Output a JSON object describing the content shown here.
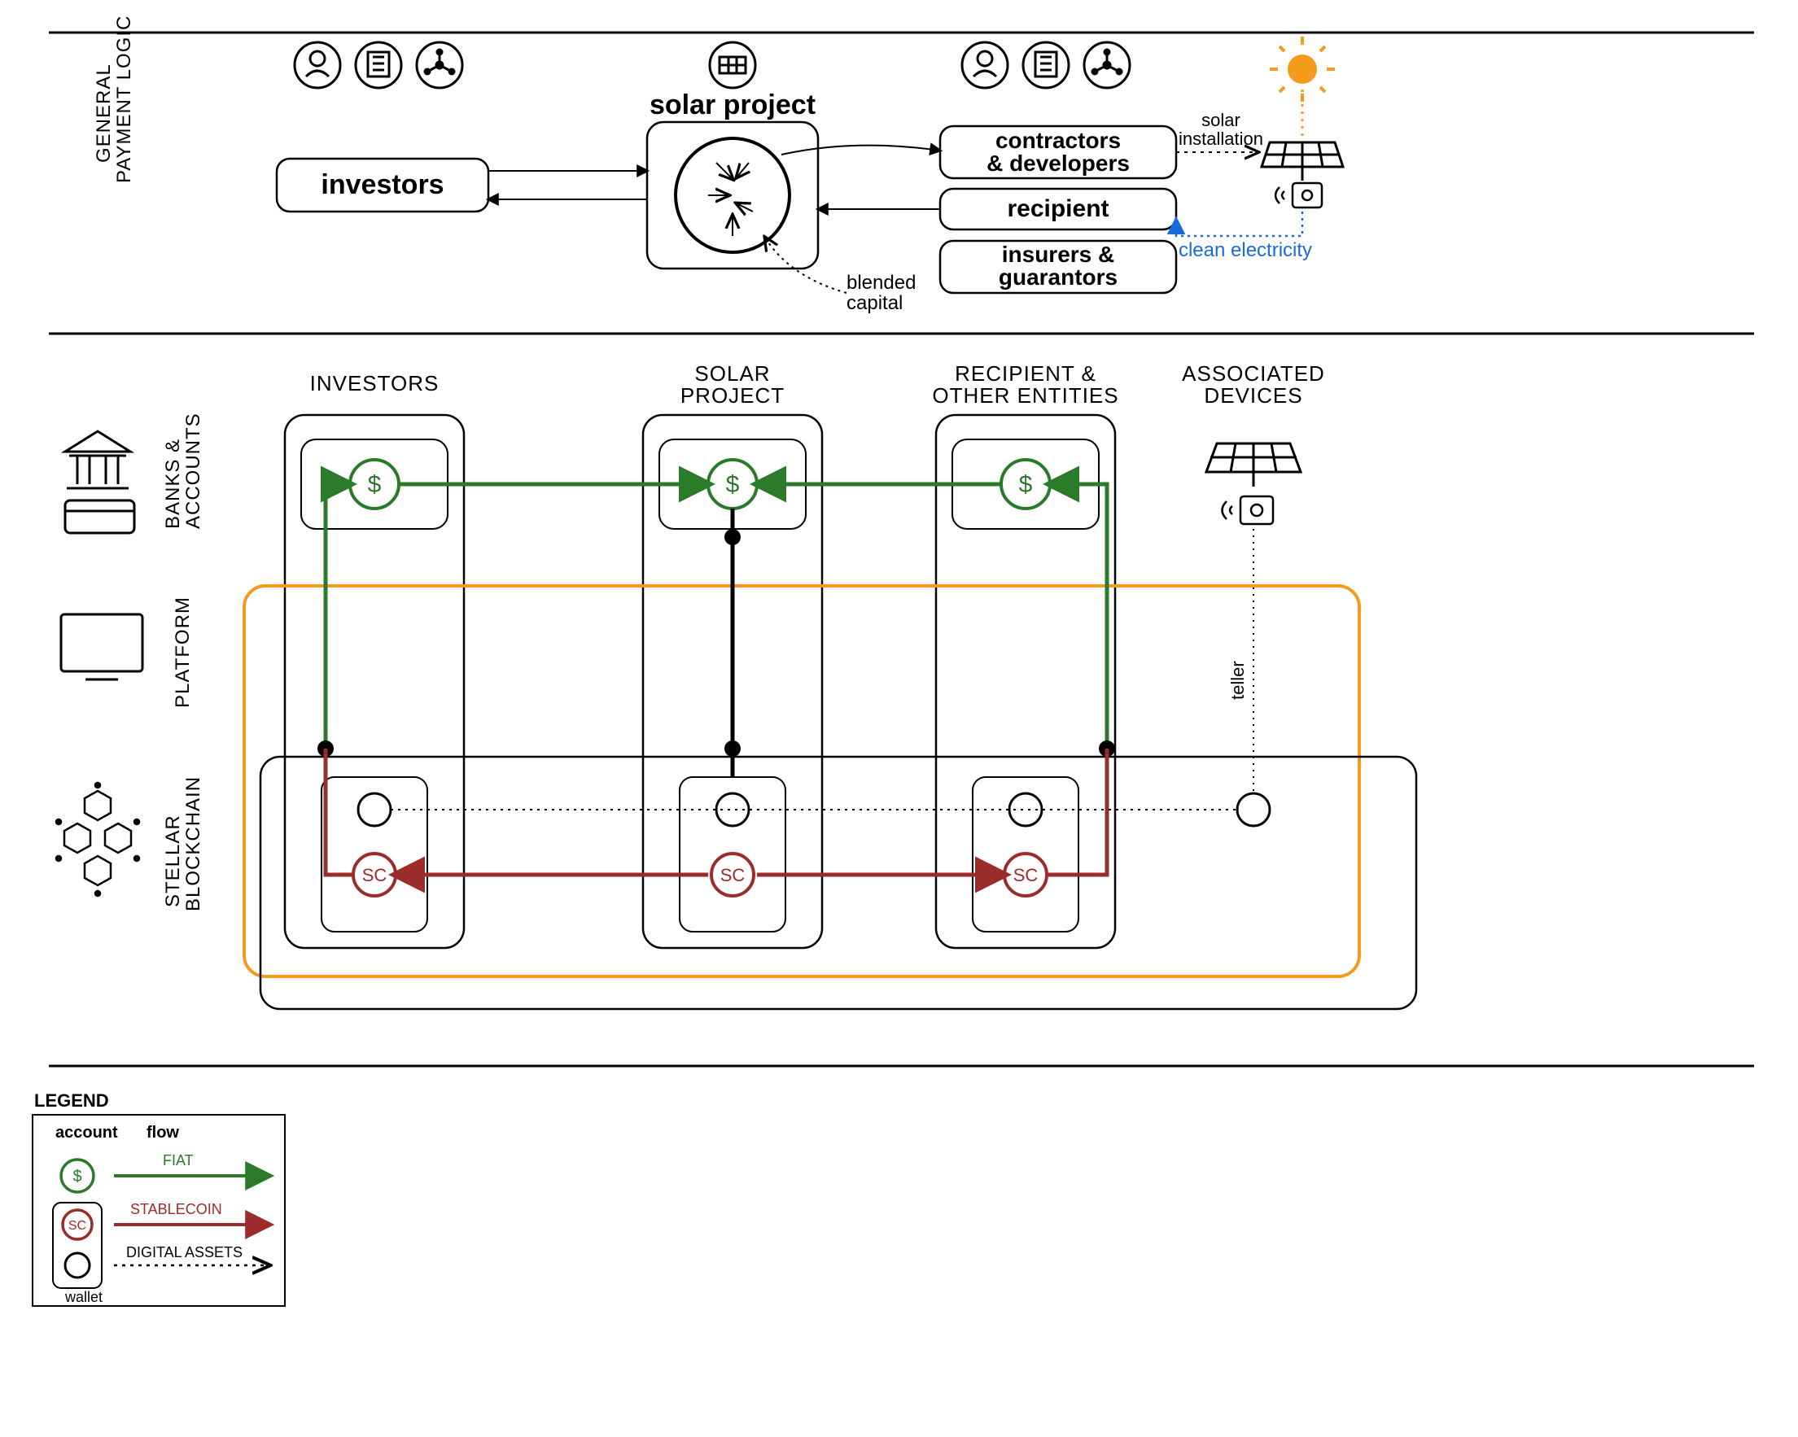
{
  "section1": {
    "side_label_line1": "GENERAL",
    "side_label_line2": "PAYMENT LOGIC",
    "solar_project": "solar project",
    "investors": "investors",
    "contractors_line1": "contractors",
    "contractors_line2": "& developers",
    "recipient": "recipient",
    "insurers_line1": "insurers &",
    "insurers_line2": "guarantors",
    "blended_line1": "blended",
    "blended_line2": "capital",
    "solar_install_line1": "solar",
    "solar_install_line2": "installation",
    "clean_electricity": "clean electricity"
  },
  "section2": {
    "col_investors": "INVESTORS",
    "col_solar_line1": "SOLAR",
    "col_solar_line2": "PROJECT",
    "col_recipient_line1": "RECIPIENT &",
    "col_recipient_line2": "OTHER ENTITIES",
    "col_assoc_line1": "ASSOCIATED",
    "col_assoc_line2": "DEVICES",
    "row_banks_line1": "BANKS &",
    "row_banks_line2": "ACCOUNTS",
    "row_platform": "PLATFORM",
    "row_stellar_line1": "STELLAR",
    "row_stellar_line2": "BLOCKCHAIN",
    "dollar": "$",
    "sc": "SC",
    "teller": "teller"
  },
  "legend": {
    "title": "LEGEND",
    "account": "account",
    "flow": "flow",
    "fiat": "FIAT",
    "stablecoin": "STABLECOIN",
    "digital_assets": "DIGITAL ASSETS",
    "wallet": "wallet",
    "dollar": "$",
    "sc": "SC"
  },
  "colors": {
    "green": "#2a7a2a",
    "red": "#9c2b2b",
    "orange": "#f49a1d",
    "blue": "#1a6bd8"
  }
}
